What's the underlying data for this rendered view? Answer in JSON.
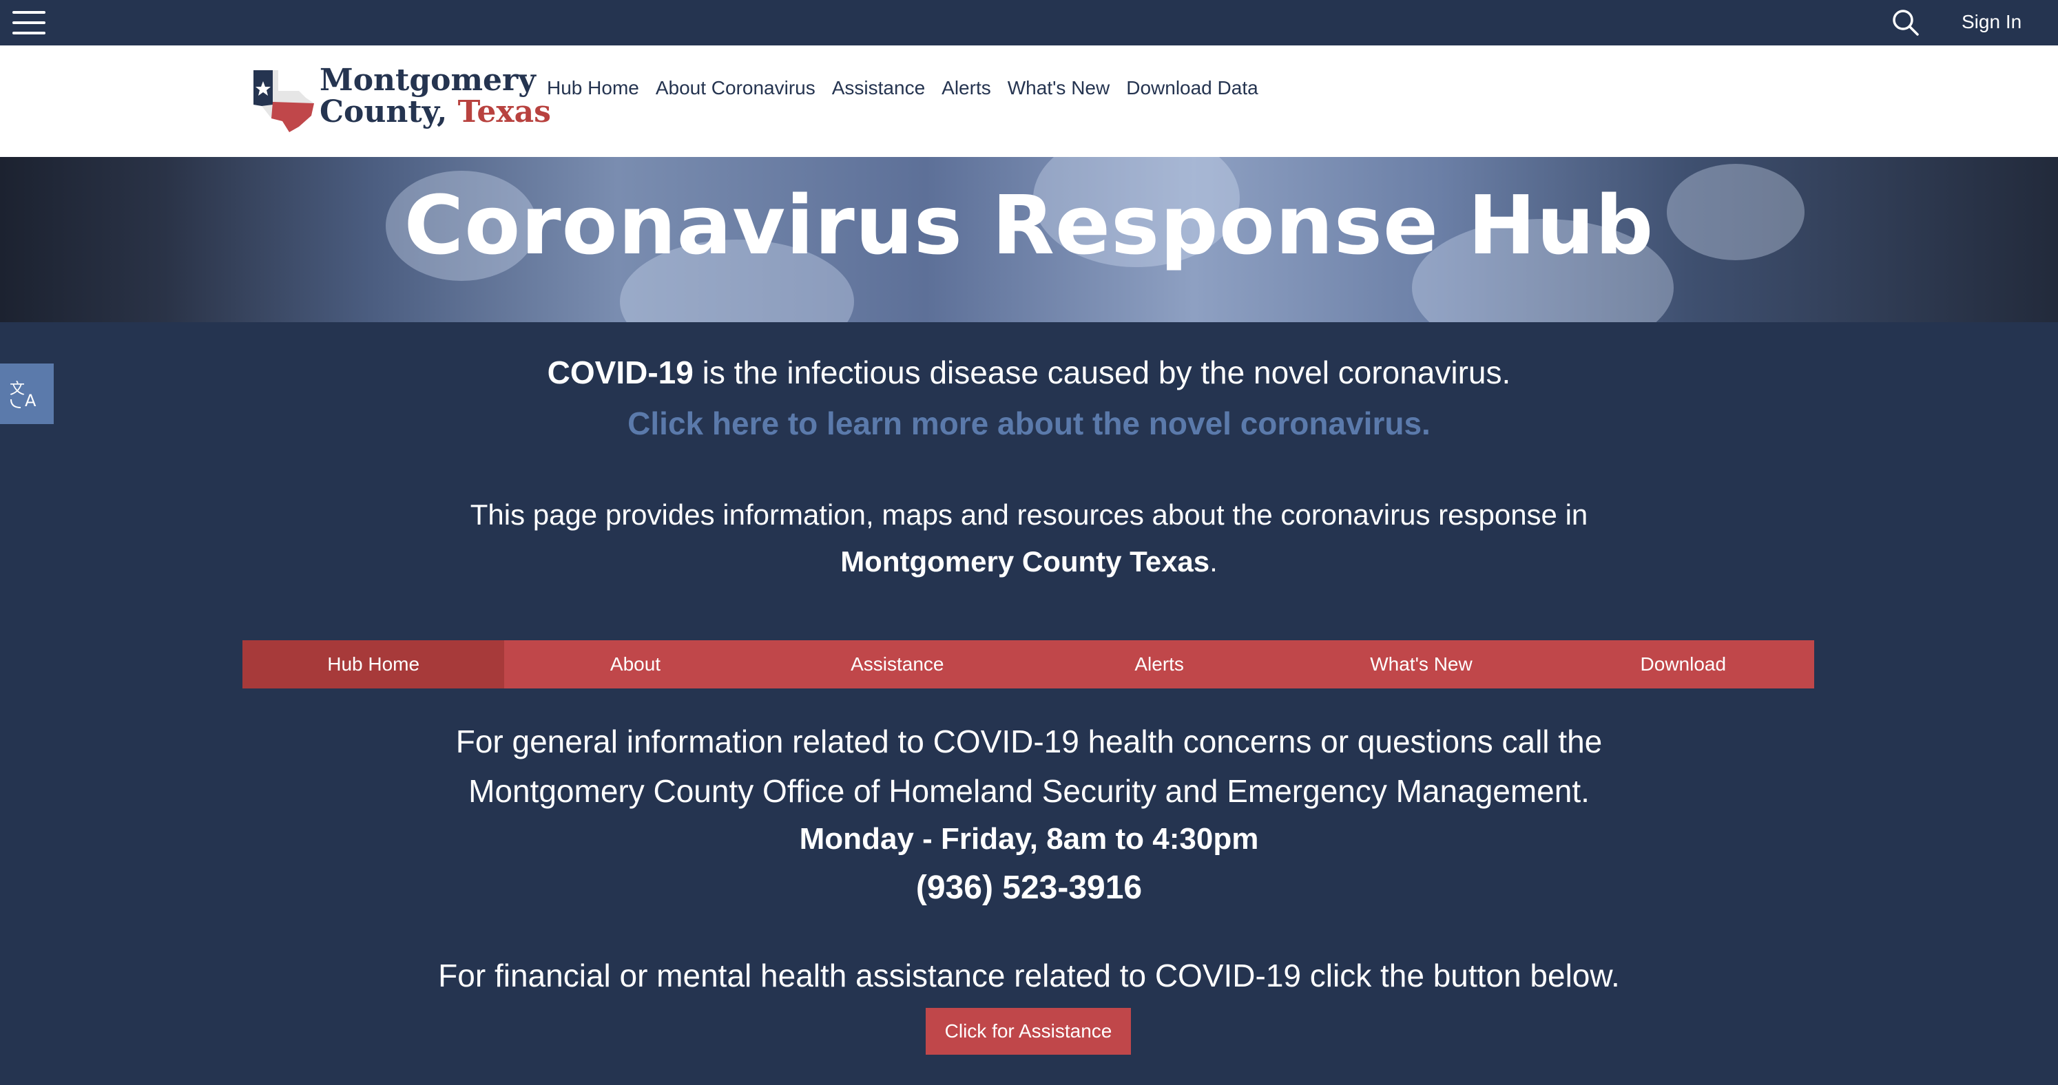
{
  "topbar": {
    "menu_icon": "hamburger-menu-icon",
    "search_icon": "search-icon",
    "signin_label": "Sign In"
  },
  "header": {
    "logo": {
      "line1": "Montgomery",
      "line2_a": "County, ",
      "line2_b": "Texas"
    },
    "nav": [
      {
        "label": "Hub Home"
      },
      {
        "label": "About Coronavirus"
      },
      {
        "label": "Assistance"
      },
      {
        "label": "Alerts"
      },
      {
        "label": "What's New"
      },
      {
        "label": "Download Data"
      }
    ]
  },
  "banner": {
    "title": "Coronavirus Response Hub"
  },
  "accessibility": {
    "icon": "translate-icon"
  },
  "intro": {
    "bold": "COVID-19",
    "rest": " is the infectious disease caused by the novel coronavirus.",
    "link": "Click here to learn more about the novel coronavirus."
  },
  "info": {
    "line1": "This page provides information, maps and resources about the coronavirus response in",
    "bold": "Montgomery County Texas",
    "end": "."
  },
  "tabs": [
    {
      "label": "Hub Home",
      "active": true
    },
    {
      "label": "About",
      "active": false
    },
    {
      "label": "Assistance",
      "active": false
    },
    {
      "label": "Alerts",
      "active": false
    },
    {
      "label": "What's New",
      "active": false
    },
    {
      "label": "Download",
      "active": false
    }
  ],
  "contact": {
    "line1": "For general information related to COVID-19 health concerns or questions call the",
    "line2": "Montgomery County Office of Homeland Security and Emergency Management.",
    "hours": "Monday - Friday, 8am to 4:30pm",
    "phone": "(936) 523-3916"
  },
  "financial": {
    "text": "For financial or mental health assistance related to COVID-19 click the button below.",
    "button_label": "Click for Assistance"
  },
  "colors": {
    "page_bg": "#253450",
    "accent_red": "#c0474a",
    "active_tab_red": "#a73a3a",
    "link_blue": "#5b7aab"
  }
}
